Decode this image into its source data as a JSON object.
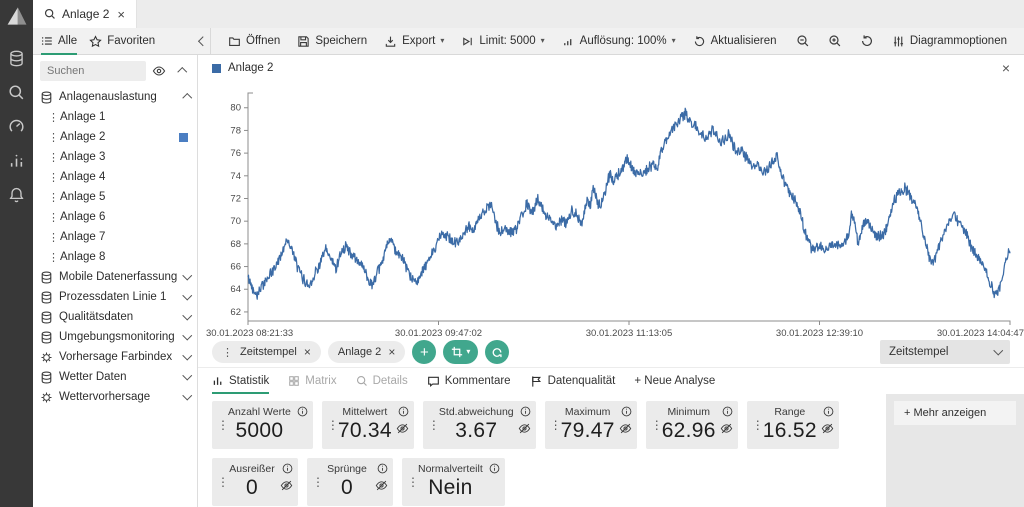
{
  "tab_bar": {
    "active_tab": "Anlage 2"
  },
  "panel_header": {
    "tabs": [
      {
        "label": "Alle"
      },
      {
        "label": "Favoriten"
      }
    ]
  },
  "toolbar": {
    "buttons": [
      {
        "label": "Öffnen"
      },
      {
        "label": "Speichern"
      },
      {
        "label": "Export",
        "caret": "▾"
      },
      {
        "label": "Limit: 5000",
        "caret": "▾"
      },
      {
        "label": "Auflösung: 100%",
        "caret": "▾"
      },
      {
        "label": "Aktualisieren"
      }
    ],
    "right_label": "Diagrammoptionen"
  },
  "sidebar": {
    "search_placeholder": "Suchen",
    "tree": [
      {
        "type": "group",
        "icon": "database-icon",
        "label": "Anlagenauslastung",
        "expanded": true
      },
      {
        "type": "child",
        "label": "Anlage 1"
      },
      {
        "type": "child",
        "label": "Anlage 2",
        "selected": true
      },
      {
        "type": "child",
        "label": "Anlage 3"
      },
      {
        "type": "child",
        "label": "Anlage 4"
      },
      {
        "type": "child",
        "label": "Anlage 5"
      },
      {
        "type": "child",
        "label": "Anlage 6"
      },
      {
        "type": "child",
        "label": "Anlage 7"
      },
      {
        "type": "child",
        "label": "Anlage 8"
      },
      {
        "type": "group",
        "icon": "database-icon",
        "label": "Mobile Datenerfassung",
        "expanded": false
      },
      {
        "type": "group",
        "icon": "database-icon",
        "label": "Prozessdaten Linie 1",
        "expanded": false
      },
      {
        "type": "group",
        "icon": "database-icon",
        "label": "Qualitätsdaten",
        "expanded": false
      },
      {
        "type": "group",
        "icon": "database-icon",
        "label": "Umgebungsmonitoring",
        "expanded": false
      },
      {
        "type": "group",
        "icon": "gear-icon",
        "label": "Vorhersage Farbindex",
        "expanded": false
      },
      {
        "type": "group",
        "icon": "database-icon",
        "label": "Wetter Daten",
        "expanded": false
      },
      {
        "type": "group",
        "icon": "gear-icon",
        "label": "Wettervorhersage",
        "expanded": false
      }
    ]
  },
  "chart_panel": {
    "legend_label": "Anlage 2"
  },
  "chart_data": {
    "type": "line",
    "series": [
      {
        "name": "Anlage 2",
        "color": "#3b6ba6"
      }
    ],
    "n_points": 5000,
    "ylim": [
      61.2,
      81.3
    ],
    "yticks": [
      62,
      64,
      66,
      68,
      70,
      72,
      74,
      76,
      78,
      80
    ],
    "xticklabels": [
      "30.01.2023 08:21:33",
      "30.01.2023 09:47:02",
      "30.01.2023 11:13:05",
      "30.01.2023 12:39:10",
      "30.01.2023 14:04:47"
    ],
    "grid": false,
    "legend_position": "top-left",
    "noise_amplitude": 0.42,
    "anchors": [
      [
        0,
        65
      ],
      [
        5,
        64
      ],
      [
        9,
        63.6
      ],
      [
        14,
        64.3
      ],
      [
        20,
        65
      ],
      [
        25,
        65.6
      ],
      [
        32,
        66.8
      ],
      [
        37,
        68
      ],
      [
        40,
        68.4
      ],
      [
        45,
        67.2
      ],
      [
        50,
        65.8
      ],
      [
        56,
        64.8
      ],
      [
        61,
        64.3
      ],
      [
        67,
        65.4
      ],
      [
        72,
        66.3
      ],
      [
        78,
        67.5
      ],
      [
        83,
        66.6
      ],
      [
        88,
        65.9
      ],
      [
        93,
        67.3
      ],
      [
        98,
        67.8
      ],
      [
        103,
        67.1
      ],
      [
        109,
        66.5
      ],
      [
        114,
        66.2
      ],
      [
        120,
        64.9
      ],
      [
        124,
        64.4
      ],
      [
        129,
        65.3
      ],
      [
        134,
        66.4
      ],
      [
        139,
        67.9
      ],
      [
        143,
        68.3
      ],
      [
        148,
        67.4
      ],
      [
        153,
        66.9
      ],
      [
        158,
        65.9
      ],
      [
        162,
        65.1
      ],
      [
        166,
        64.7
      ],
      [
        171,
        65
      ],
      [
        176,
        65.8
      ],
      [
        181,
        66.6
      ],
      [
        186,
        67.5
      ],
      [
        191,
        68.6
      ],
      [
        195,
        69.1
      ],
      [
        199,
        68.6
      ],
      [
        204,
        68.3
      ],
      [
        209,
        68
      ],
      [
        213,
        68.6
      ],
      [
        217,
        69.1
      ],
      [
        221,
        69.5
      ],
      [
        225,
        69.2
      ],
      [
        229,
        69.9
      ],
      [
        233,
        70.4
      ],
      [
        238,
        71.1
      ],
      [
        243,
        71.4
      ],
      [
        248,
        69.8
      ],
      [
        252,
        68.9
      ],
      [
        257,
        69.4
      ],
      [
        261,
        69
      ],
      [
        265,
        69.1
      ],
      [
        269,
        69.3
      ],
      [
        274,
        70.6
      ],
      [
        279,
        71.5
      ],
      [
        284,
        70.6
      ],
      [
        289,
        72
      ],
      [
        294,
        71.2
      ],
      [
        299,
        70.4
      ],
      [
        304,
        70.1
      ],
      [
        309,
        69.5
      ],
      [
        314,
        70.1
      ],
      [
        319,
        69.8
      ],
      [
        324,
        71
      ],
      [
        329,
        70.6
      ],
      [
        334,
        69.8
      ],
      [
        339,
        71.8
      ],
      [
        342,
        71.2
      ],
      [
        345,
        72.9
      ],
      [
        349,
        71.8
      ],
      [
        352,
        71.2
      ],
      [
        357,
        72.6
      ],
      [
        362,
        74.2
      ],
      [
        365,
        73.5
      ],
      [
        370,
        74.1
      ],
      [
        374,
        74.6
      ],
      [
        379,
        75.6
      ],
      [
        383,
        74.8
      ],
      [
        387,
        74.1
      ],
      [
        391,
        74.5
      ],
      [
        395,
        74.2
      ],
      [
        400,
        74.6
      ],
      [
        405,
        75
      ],
      [
        409,
        74.6
      ],
      [
        413,
        76.3
      ],
      [
        417,
        76.8
      ],
      [
        421,
        77.5
      ],
      [
        425,
        78.2
      ],
      [
        429,
        78.6
      ],
      [
        433,
        79.1
      ],
      [
        437,
        79.5
      ],
      [
        441,
        78.9
      ],
      [
        445,
        78.6
      ],
      [
        449,
        78.2
      ],
      [
        453,
        77.8
      ],
      [
        457,
        77.4
      ],
      [
        461,
        77.6
      ],
      [
        465,
        78
      ],
      [
        469,
        77.5
      ],
      [
        473,
        77
      ],
      [
        477,
        77.3
      ],
      [
        481,
        77.6
      ],
      [
        485,
        76.8
      ],
      [
        489,
        76.1
      ],
      [
        493,
        76.3
      ],
      [
        497,
        75.8
      ],
      [
        501,
        75.2
      ],
      [
        505,
        74.6
      ],
      [
        509,
        75
      ],
      [
        513,
        74.7
      ],
      [
        517,
        74.4
      ],
      [
        521,
        74.8
      ],
      [
        525,
        75.3
      ],
      [
        529,
        75.8
      ],
      [
        533,
        74
      ],
      [
        537,
        73.3
      ],
      [
        541,
        72.6
      ],
      [
        545,
        72.1
      ],
      [
        549,
        71.4
      ],
      [
        552,
        70.9
      ],
      [
        556,
        69.4
      ],
      [
        560,
        68.3
      ],
      [
        564,
        67.4
      ],
      [
        568,
        67.7
      ],
      [
        572,
        67.9
      ],
      [
        576,
        67.6
      ],
      [
        580,
        67.7
      ],
      [
        584,
        67.9
      ],
      [
        588,
        67.8
      ],
      [
        592,
        68
      ],
      [
        596,
        68.2
      ],
      [
        600,
        68.6
      ],
      [
        604,
        70.7
      ],
      [
        607,
        69.9
      ],
      [
        610,
        67.9
      ],
      [
        613,
        68.9
      ],
      [
        616,
        69.8
      ],
      [
        620,
        70
      ],
      [
        623,
        69.3
      ],
      [
        626,
        69
      ],
      [
        629,
        68.6
      ],
      [
        633,
        68.8
      ],
      [
        637,
        69
      ],
      [
        641,
        70.2
      ],
      [
        645,
        71.5
      ],
      [
        649,
        72.3
      ],
      [
        653,
        72.7
      ],
      [
        657,
        72.9
      ],
      [
        661,
        72.4
      ],
      [
        665,
        71.9
      ],
      [
        669,
        71
      ],
      [
        673,
        69.7
      ],
      [
        677,
        68.2
      ],
      [
        681,
        67
      ],
      [
        685,
        66.3
      ],
      [
        689,
        67.2
      ],
      [
        693,
        68.4
      ],
      [
        697,
        69
      ],
      [
        701,
        69.9
      ],
      [
        705,
        70.6
      ],
      [
        709,
        70.1
      ],
      [
        713,
        69.6
      ],
      [
        717,
        69.3
      ],
      [
        721,
        68.1
      ],
      [
        725,
        67.4
      ],
      [
        729,
        66.9
      ],
      [
        733,
        66.4
      ],
      [
        737,
        65.7
      ],
      [
        741,
        64.8
      ],
      [
        745,
        63.9
      ],
      [
        748,
        63.5
      ],
      [
        751,
        63.9
      ],
      [
        754,
        64.8
      ],
      [
        757,
        66.5
      ],
      [
        760,
        67.3
      ],
      [
        762,
        67.2
      ]
    ]
  },
  "query_bar": {
    "chips": [
      {
        "label": "Zeitstempel"
      },
      {
        "label": "Anlage 2"
      }
    ],
    "x_axis_select": "Zeitstempel"
  },
  "analysis_tabs": [
    {
      "label": "Statistik",
      "active": true
    },
    {
      "label": "Matrix",
      "disabled": true
    },
    {
      "label": "Details",
      "disabled": true
    },
    {
      "label": "Kommentare"
    },
    {
      "label": "Datenqualität"
    },
    {
      "label": "+ Neue Analyse"
    }
  ],
  "stats": {
    "rows": [
      [
        {
          "label": "Anzahl Werte",
          "value": "5000",
          "hideable": false
        },
        {
          "label": "Mittelwert",
          "value": "70.34",
          "hideable": true
        },
        {
          "label": "Std.abweichung",
          "value": "3.67",
          "hideable": true
        },
        {
          "label": "Maximum",
          "value": "79.47",
          "hideable": true
        },
        {
          "label": "Minimum",
          "value": "62.96",
          "hideable": true
        },
        {
          "label": "Range",
          "value": "16.52",
          "hideable": true
        }
      ],
      [
        {
          "label": "Ausreißer",
          "value": "0",
          "hideable": true
        },
        {
          "label": "Sprünge",
          "value": "0",
          "hideable": true
        },
        {
          "label": "Normalverteilt",
          "value": "Nein",
          "hideable": false
        }
      ]
    ],
    "more_button": "+ Mehr anzeigen"
  },
  "colors": {
    "accent_teal": "#41a78d",
    "underline_green": "#2d9c74",
    "line_blue": "#3b6ba6",
    "rail_bg": "#383838",
    "selected_square": "#4b7ec2"
  }
}
